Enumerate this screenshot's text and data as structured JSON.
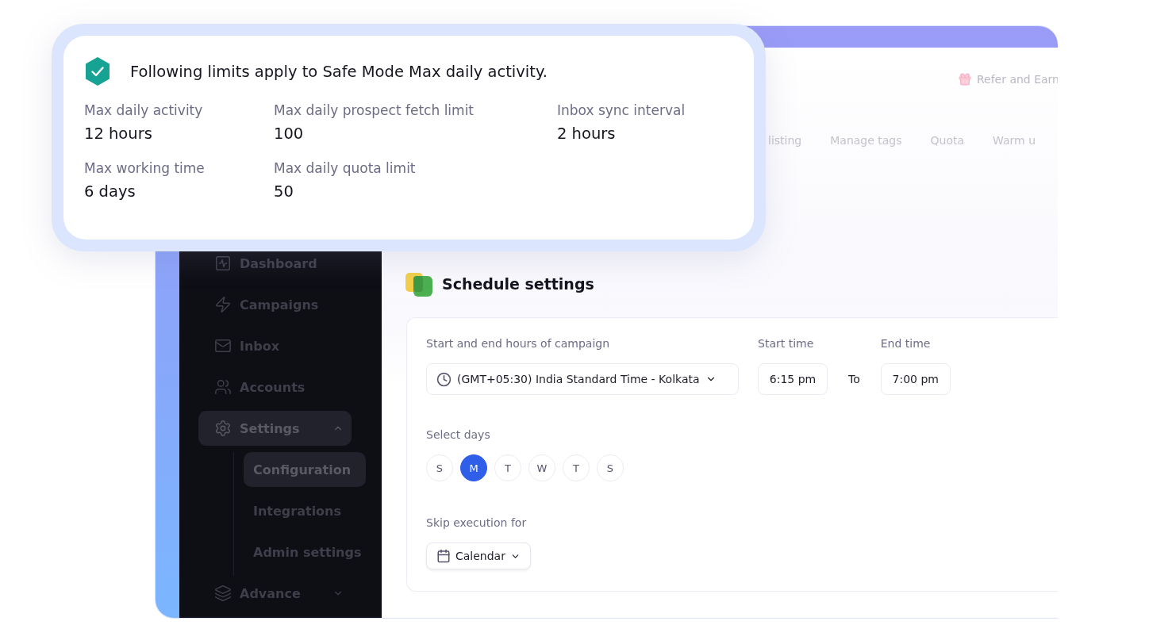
{
  "limits_card": {
    "title": "Following limits apply to Safe Mode Max daily activity.",
    "items": [
      {
        "label": "Max daily activity",
        "value": "12 hours"
      },
      {
        "label": "Max daily prospect fetch limit",
        "value": "100"
      },
      {
        "label": "Inbox sync interval",
        "value": "2 hours"
      },
      {
        "label": "Max working time",
        "value": "6 days"
      },
      {
        "label": "Max daily quota limit",
        "value": "50"
      }
    ]
  },
  "header": {
    "refer_link": "Refer and Earn"
  },
  "tabs": [
    {
      "label": "listing",
      "selected": false
    },
    {
      "label": "Manage tags",
      "selected": false
    },
    {
      "label": "Quota",
      "selected": false
    },
    {
      "label": "Warm u",
      "selected": false
    }
  ],
  "sidebar": {
    "items": [
      {
        "kind": "link",
        "label": "Dashboard",
        "selected": false
      },
      {
        "kind": "link",
        "label": "Campaigns",
        "selected": false
      },
      {
        "kind": "link",
        "label": "Inbox",
        "selected": false
      },
      {
        "kind": "link",
        "label": "Accounts",
        "selected": false
      },
      {
        "kind": "group",
        "label": "Settings",
        "selected": true,
        "expanded": true,
        "children": [
          {
            "label": "Configuration",
            "selected": true
          },
          {
            "label": "Integrations",
            "selected": false
          },
          {
            "label": "Admin settings",
            "selected": false
          }
        ]
      },
      {
        "kind": "group",
        "label": "Advance",
        "selected": false,
        "expanded": false
      }
    ]
  },
  "schedule": {
    "title": "Schedule settings",
    "hours_label": "Start and end hours of campaign",
    "timezone": "(GMT+05:30) India Standard Time - Kolkata",
    "start_label": "Start time",
    "start_time": "6:15 pm",
    "separator": "To",
    "end_label": "End time",
    "end_time": "7:00 pm",
    "days_label": "Select days",
    "days": [
      {
        "label": "S",
        "selected": false
      },
      {
        "label": "M",
        "selected": true
      },
      {
        "label": "T",
        "selected": false
      },
      {
        "label": "W",
        "selected": false
      },
      {
        "label": "T",
        "selected": false
      },
      {
        "label": "S",
        "selected": false
      }
    ],
    "skip_label": "Skip execution for",
    "skip_button": "Calendar"
  }
}
